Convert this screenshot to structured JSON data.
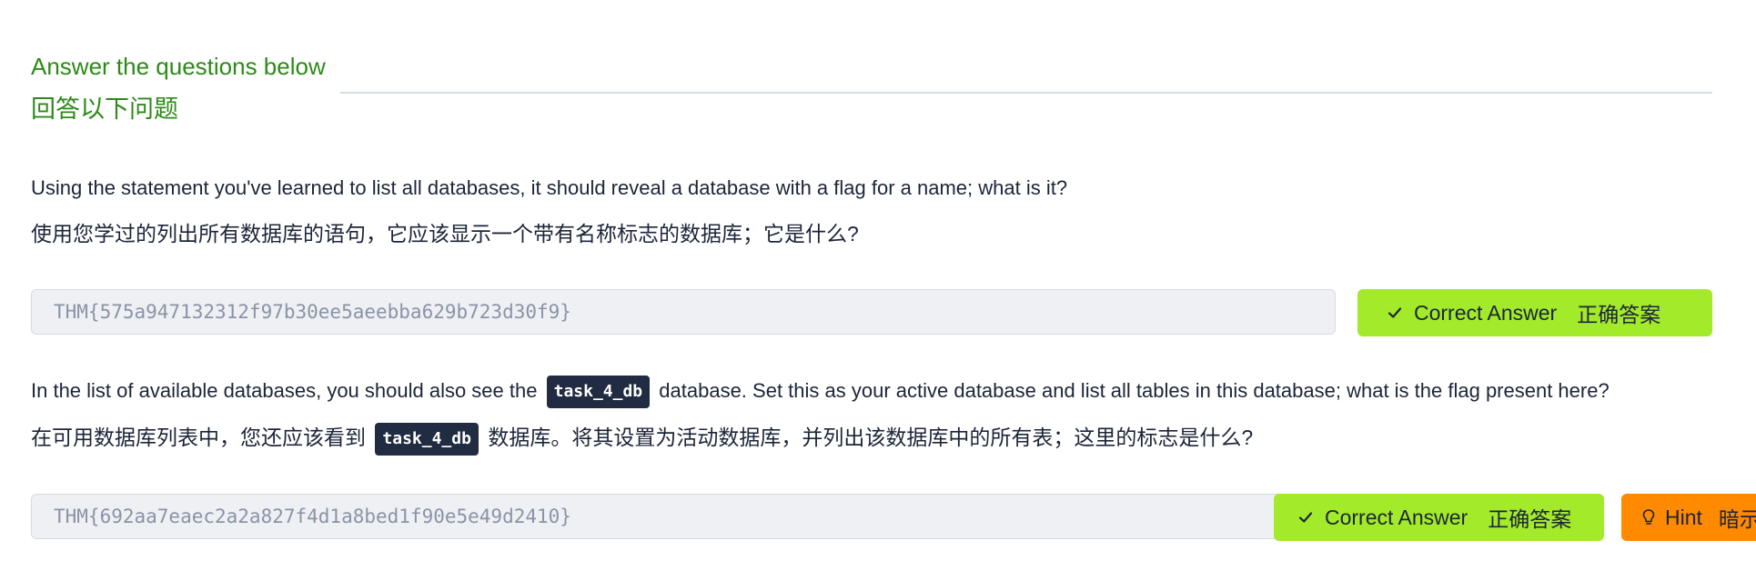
{
  "heading": {
    "title_en": "Answer the questions below",
    "title_zh": "回答以下问题"
  },
  "questions": [
    {
      "text_en": "Using the statement you've learned to list all databases, it should reveal a database with a flag for a name; what is it?",
      "text_zh": "使用您学过的列出所有数据库的语句，它应该显示一个带有名称标志的数据库；它是什么?",
      "answer": "THM{575a947132312f97b30ee5aeebba629b723d30f9}",
      "button_label_en": "Correct Answer",
      "button_label_zh": "正确答案"
    },
    {
      "text_en_before": "In the list of available databases, you should also see the",
      "code": "task_4_db",
      "text_en_after": "database. Set this as your active database and list all tables in this database; what is the flag present here?",
      "text_zh_before": "在可用数据库列表中，您还应该看到",
      "text_zh_after": "数据库。将其设置为活动数据库，并列出该数据库中的所有表；这里的标志是什么?",
      "answer": "THM{692aa7eaec2a2a827f4d1a8bed1f90e5e49d2410}",
      "button_label_en": "Correct Answer",
      "button_label_zh": "正确答案",
      "hint_label_en": "Hint",
      "hint_label_zh": "暗示"
    }
  ],
  "colors": {
    "heading_green": "#2d8a18",
    "correct_button": "#a3ea2a",
    "hint_button": "#ff8a00",
    "code_tag_bg": "#212c42",
    "field_bg": "#eef0f4"
  },
  "icons": {
    "correct": "check-icon",
    "hint": "lightbulb-icon"
  }
}
